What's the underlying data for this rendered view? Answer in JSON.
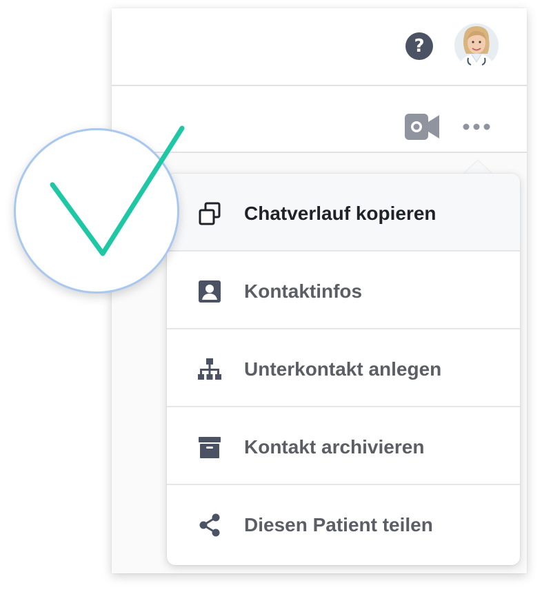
{
  "header": {
    "help_icon": "question-circle-icon",
    "help_label": "?",
    "avatar_icon": "user-avatar"
  },
  "chat_toolbar": {
    "video_icon": "video-camera-icon",
    "more_icon": "more-horizontal-icon"
  },
  "menu": {
    "items": [
      {
        "label": "Chatverlauf kopieren",
        "icon": "copy-icon",
        "active": true
      },
      {
        "label": "Kontaktinfos",
        "icon": "contact-card-icon",
        "active": false
      },
      {
        "label": "Unterkontakt anlegen",
        "icon": "hierarchy-icon",
        "active": false
      },
      {
        "label": "Kontakt archivieren",
        "icon": "archive-box-icon",
        "active": false
      },
      {
        "label": "Diesen Patient teilen",
        "icon": "share-icon",
        "active": false
      }
    ]
  },
  "check_badge": {
    "icon": "checkmark-icon"
  },
  "colors": {
    "accent_check": "#1ec8a5",
    "badge_border": "#a9c8f0",
    "icon_gray": "#4b5263",
    "toolbar_icon_gray": "#8f949e",
    "active_text": "#1f2228",
    "text_gray": "#5b5e64"
  }
}
